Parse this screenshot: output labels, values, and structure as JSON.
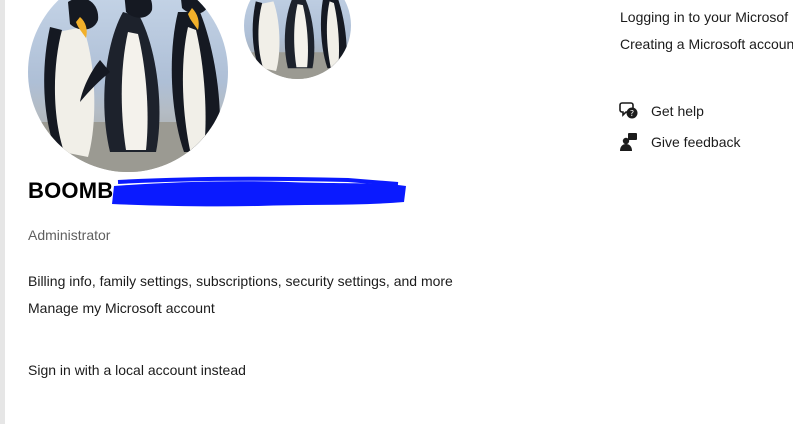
{
  "profile": {
    "name_visible": "BOOMB",
    "role": "Administrator",
    "account_description": "Billing info, family settings, subscriptions, security settings, and more",
    "manage_link": "Manage my Microsoft account",
    "local_account_link": "Sign in with a local account instead",
    "redaction_color": "#0a1aff"
  },
  "related": {
    "links": [
      "Logging in to your Microsof",
      "Creating a Microsoft accoun"
    ]
  },
  "support": {
    "get_help": {
      "label": "Get help",
      "icon": "help-chat-icon"
    },
    "give_feedback": {
      "label": "Give feedback",
      "icon": "feedback-person-icon"
    }
  }
}
